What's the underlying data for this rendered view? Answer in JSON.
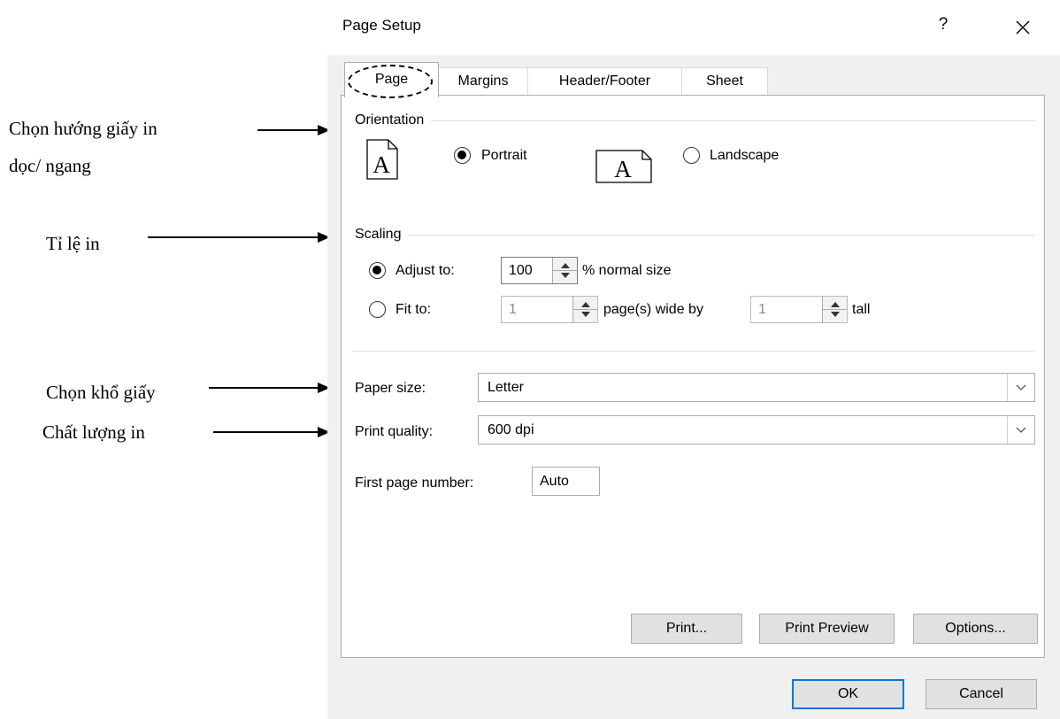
{
  "annotations": {
    "orientation_line1": "Chọn hướng giấy in",
    "orientation_line2": "dọc/ ngang",
    "scaling": "Tỉ lệ in",
    "paper_size": "Chọn khổ giấy",
    "print_quality": "Chất lượng in"
  },
  "dialog": {
    "title": "Page Setup",
    "help": "?",
    "tabs": [
      "Page",
      "Margins",
      "Header/Footer",
      "Sheet"
    ],
    "orientation": {
      "label": "Orientation",
      "portrait": "Portrait",
      "landscape": "Landscape",
      "selected": "Portrait",
      "icon_letter": "A"
    },
    "scaling": {
      "label": "Scaling",
      "adjust_to": "Adjust to:",
      "adjust_value": "100",
      "adjust_suffix": "% normal size",
      "fit_to": "Fit to:",
      "fit_wide": "1",
      "fit_wide_suffix": "page(s) wide by",
      "fit_tall": "1",
      "fit_tall_suffix": "tall",
      "selected": "Adjust to"
    },
    "paper_size": {
      "label": "Paper size:",
      "value": "Letter"
    },
    "print_quality": {
      "label": "Print quality:",
      "value": "600 dpi"
    },
    "first_page_number": {
      "label": "First page number:",
      "value": "Auto"
    },
    "buttons": {
      "print": "Print...",
      "print_preview": "Print Preview",
      "options": "Options...",
      "ok": "OK",
      "cancel": "Cancel"
    }
  }
}
